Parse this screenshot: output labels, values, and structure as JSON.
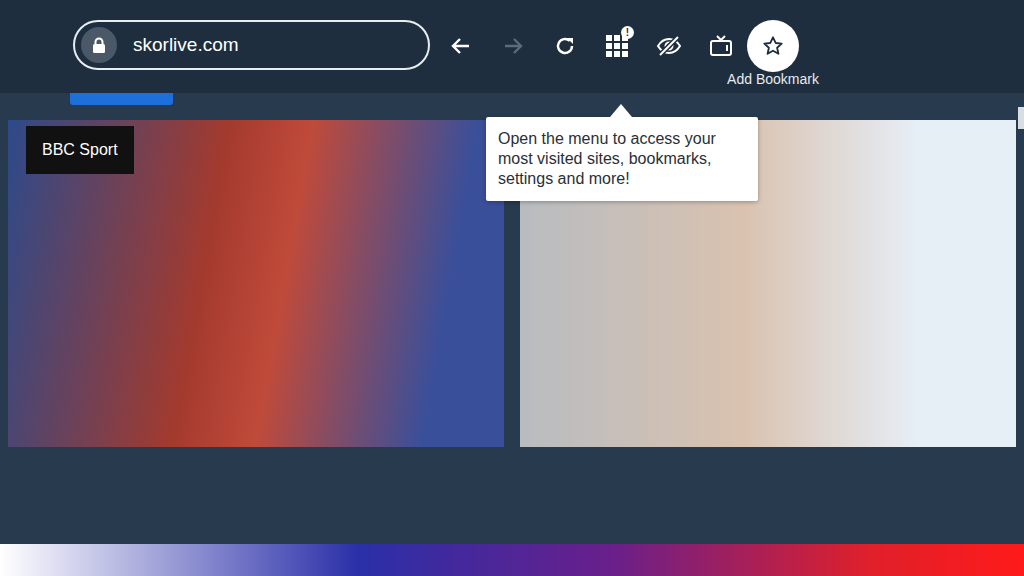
{
  "address_bar": {
    "url": "skorlive.com",
    "secure": true
  },
  "toolbar_buttons": [
    {
      "kind": "back",
      "disabled": false,
      "focused": false,
      "badge": "",
      "label": ""
    },
    {
      "kind": "forward",
      "disabled": true,
      "focused": false,
      "badge": "",
      "label": ""
    },
    {
      "kind": "reload",
      "disabled": false,
      "focused": false,
      "badge": "",
      "label": ""
    },
    {
      "kind": "menu",
      "disabled": false,
      "focused": false,
      "badge": "!",
      "label": ""
    },
    {
      "kind": "private",
      "disabled": false,
      "focused": false,
      "badge": "",
      "label": ""
    },
    {
      "kind": "tv",
      "disabled": false,
      "focused": false,
      "badge": "",
      "label": ""
    },
    {
      "kind": "bookmark",
      "disabled": false,
      "focused": true,
      "badge": "",
      "label": "Add Bookmark"
    }
  ],
  "tooltip": {
    "text": "Open the menu to access your most visited sites, bookmarks, settings and more!"
  },
  "cards": [
    {
      "badge": "BBC Sport"
    },
    {
      "badge": ""
    }
  ]
}
